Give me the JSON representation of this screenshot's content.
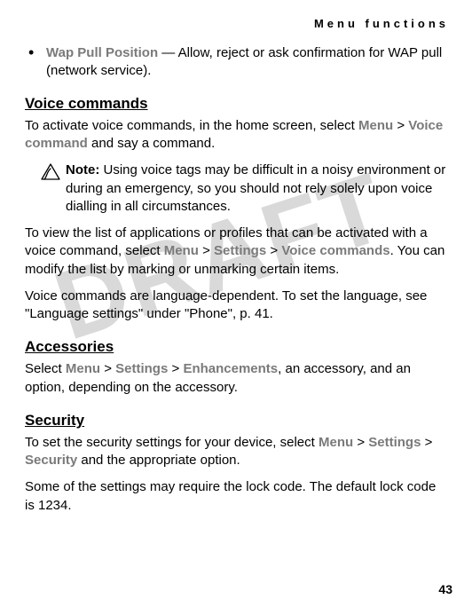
{
  "header": {
    "title": "Menu functions"
  },
  "watermark": "DRAFT",
  "bullet": {
    "term": "Wap Pull Position",
    "dash": " — ",
    "desc": "Allow, reject or ask confirmation for WAP pull (network service)."
  },
  "voice": {
    "heading": "Voice commands",
    "p1a": "To activate voice commands, in the home screen, select ",
    "menu": "Menu",
    "gt": " > ",
    "voice_cmd": "Voice command",
    "p1b": " and say a command.",
    "note_label": "Note:",
    "note_text": " Using voice tags may be difficult in a noisy environment or during an emergency, so you should not rely solely upon voice dialling in all circumstances.",
    "p2a": "To view the list of applications or profiles that can be activated with a voice command, select ",
    "settings": "Settings",
    "voice_cmds": "Voice commands",
    "p2b": ". You can modify the list by marking or unmarking certain items.",
    "p3": "Voice commands are language-dependent. To set the language, see \"Language settings\" under \"Phone\", p. 41."
  },
  "accessories": {
    "heading": "Accessories",
    "pa": "Select ",
    "menu": "Menu",
    "gt": " > ",
    "settings": "Settings",
    "enh": "Enhancements",
    "pb": ", an accessory, and an option, depending on the accessory."
  },
  "security": {
    "heading": "Security",
    "p1a": "To set the security settings for your device, select ",
    "menu": "Menu",
    "gt": " > ",
    "settings": "Settings",
    "sec": "Security",
    "p1b": " and the appropriate option.",
    "p2": "Some of the settings may require the lock code. The default lock code is 1234."
  },
  "page_number": "43"
}
